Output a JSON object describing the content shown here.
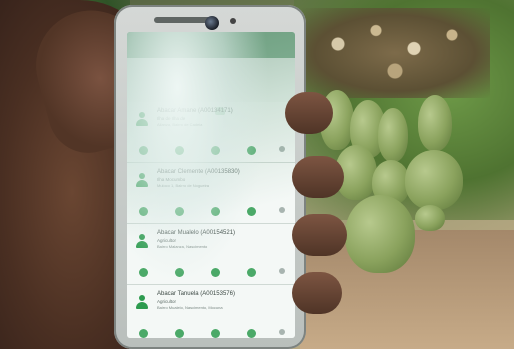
{
  "screen": {
    "contacts": [
      {
        "name": "Abacar Amane (A00134171)",
        "line1": "Ilha de Ilha de",
        "line2": "Alianza, Bairro de Cadeia"
      },
      {
        "name": "Abacar Clemente (A00135830)",
        "line1": "Ilha Mocumbo",
        "line2": "Muloco 1, Bairro de Nogueira"
      },
      {
        "name": "Abacar Mualelo (A00154521)",
        "line1": "Agricultor",
        "line2": "Bairro Malanza, Nascimento"
      },
      {
        "name": "Abacar Tanuela (A00153576)",
        "line1": "Agricultor",
        "line2": "Bairro Mualelo, Nascimento, Mocuna"
      }
    ]
  }
}
